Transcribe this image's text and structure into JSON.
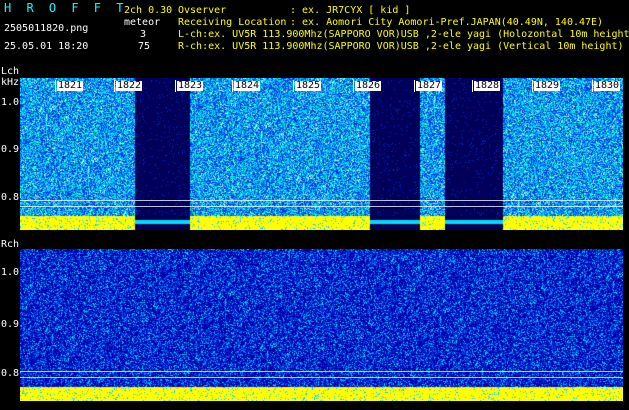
{
  "header": {
    "app_name": "H R O F F T",
    "channel_info": "2ch 0.30",
    "mode": "meteor",
    "count1": "3",
    "count2": "75",
    "filename": "2505011820.png",
    "datetime": "25.05.01 18:20",
    "observer_label": "Ovserver",
    "observer_value": ": ex. JR7CYX [ kid ]",
    "location_label": "Receiving Location",
    "location_value": ": ex. Aomori City Aomori-Pref.JAPAN(40.49N, 140.47E)",
    "lch_line": "L-ch:ex. UV5R 113.900Mhz(SAPPORO VOR)USB ,2-ele yagi (Holozontal 10m height)",
    "rch_line": "R-ch:ex. UV5R 113.900Mhz(SAPPORO VOR)USB ,2-ele yagi (Vertical 10m height)"
  },
  "lch_panel": {
    "label": "Lch",
    "unit": "kHz",
    "y_ticks": [
      "1.0",
      "0.9",
      "0.8"
    ],
    "time_labels": [
      "1821",
      "1822",
      "1823",
      "1824",
      "1825",
      "1826",
      "1827",
      "1828",
      "1829",
      "1830"
    ]
  },
  "rch_panel": {
    "label": "Rch",
    "y_ticks": [
      "1.0",
      "0.9",
      "0.8"
    ]
  },
  "colors": {
    "background": "#000000",
    "noise_low": "#0000c0",
    "noise_mid": "#00a0ff",
    "noise_high": "#00ffff",
    "gap": "#000060",
    "carrier": "#ffff00",
    "header_cyan": "#00ffff",
    "header_yellow": "#ffff00"
  }
}
